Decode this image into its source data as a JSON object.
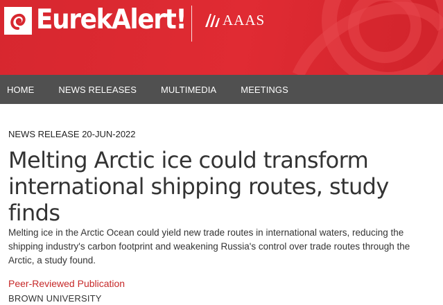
{
  "header": {
    "logo_text": "EurekAlert!",
    "partner_text": "AAAS"
  },
  "nav": {
    "items": [
      "HOME",
      "NEWS RELEASES",
      "MULTIMEDIA",
      "MEETINGS"
    ]
  },
  "article": {
    "dateline": "NEWS RELEASE 20-JUN-2022",
    "headline": "Melting Arctic ice could transform international shipping routes, study finds",
    "summary": "Melting ice in the Arctic Ocean could yield new trade routes in international waters, reducing the shipping industry's carbon footprint and weakening Russia's control over trade routes through the Arctic, a study found.",
    "publication_type": "Peer-Reviewed Publication",
    "institution": "BROWN UNIVERSITY"
  },
  "colors": {
    "brand_red": "#d7272f",
    "nav_bg": "#505050",
    "link_red": "#c62828"
  }
}
